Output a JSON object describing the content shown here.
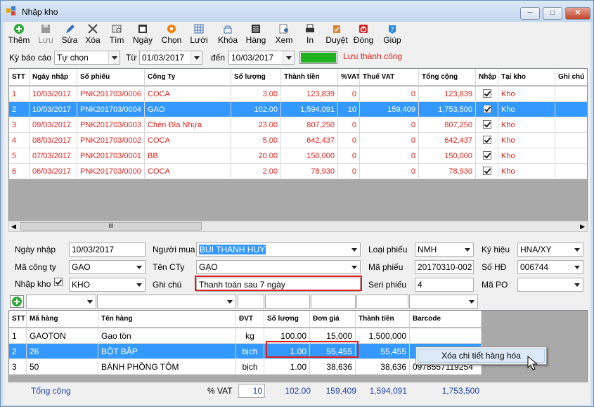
{
  "window": {
    "title": "Nhập kho",
    "btn_min": "─",
    "btn_max": "□",
    "btn_close": "✕"
  },
  "toolbar": [
    {
      "label": "Thêm",
      "icon": "add-icon",
      "color": "#2fa836",
      "enabled": true
    },
    {
      "label": "Lưu",
      "icon": "save-icon",
      "color": "#9a9a9a",
      "enabled": false
    },
    {
      "label": "Sửa",
      "icon": "edit-icon",
      "color": "#3a6fb6",
      "enabled": true
    },
    {
      "label": "Xóa",
      "icon": "delete-icon",
      "color": "#444444",
      "enabled": true
    },
    {
      "label": "Tìm",
      "icon": "find-icon",
      "color": "#555555",
      "enabled": true
    },
    {
      "label": "Ngày",
      "icon": "calendar-icon",
      "color": "#333333",
      "enabled": true
    },
    {
      "label": "Chọn",
      "icon": "gear-icon",
      "color": "#f07d00",
      "enabled": true
    },
    {
      "label": "Lưới",
      "icon": "grid-icon",
      "color": "#3a6fb6",
      "enabled": true
    },
    {
      "label": "Khóa",
      "icon": "lock-icon",
      "color": "#3a6fb6",
      "enabled": true
    },
    {
      "label": "Hàng",
      "icon": "goods-icon",
      "color": "#333333",
      "enabled": true
    },
    {
      "label": "Xem",
      "icon": "preview-icon",
      "color": "#3a6fb6",
      "enabled": true
    },
    {
      "label": "In",
      "icon": "print-icon",
      "color": "#333333",
      "enabled": true
    },
    {
      "label": "Duyệt",
      "icon": "approve-icon",
      "color": "#d9822b",
      "enabled": true
    },
    {
      "label": "Đóng",
      "icon": "power-icon",
      "color": "#d02020",
      "enabled": true
    },
    {
      "label": "Giúp",
      "icon": "help-icon",
      "color": "#2a8ad9",
      "enabled": true
    }
  ],
  "filter": {
    "period_label": "Kỳ báo cáo",
    "period_value": "Tự chọn",
    "from_label": "Từ",
    "from_date": "01/03/2017",
    "to_label": "đến",
    "to_date": "10/03/2017",
    "status_text": "Lưu thành công",
    "status_color": "#e0201a",
    "progress_color": "#1fb31f"
  },
  "receipts": {
    "columns": [
      "STT",
      "Ngày nhập",
      "Số phiếu",
      "Công Ty",
      "Số lượng",
      "Thành tiền",
      "%VAT",
      "Thuế VAT",
      "Tổng cộng",
      "Nhập",
      "Tại kho",
      "Ghi chú"
    ],
    "rows": [
      {
        "stt": "1",
        "date": "10/03/2017",
        "no": "PNK201703/0006",
        "company": "COCA",
        "qty": "3.00",
        "amount": "123,839",
        "vat": "0",
        "tax": "0",
        "total": "123,839",
        "kho": "Kho",
        "sel": false
      },
      {
        "stt": "2",
        "date": "10/03/2017",
        "no": "PNK201703/0004",
        "company": "GAO",
        "qty": "102.00",
        "amount": "1,594,091",
        "vat": "10",
        "tax": "159,409",
        "total": "1,753,500",
        "kho": "Kho",
        "sel": true
      },
      {
        "stt": "3",
        "date": "09/03/2017",
        "no": "PNK201703/0003",
        "company": "Chén Đĩa Nhựa",
        "qty": "23.00",
        "amount": "807,250",
        "vat": "0",
        "tax": "0",
        "total": "807,250",
        "kho": "Kho",
        "sel": false
      },
      {
        "stt": "4",
        "date": "08/03/2017",
        "no": "PNK201703/0002",
        "company": "COCA",
        "qty": "5.00",
        "amount": "642,437",
        "vat": "0",
        "tax": "0",
        "total": "642,437",
        "kho": "Kho",
        "sel": false
      },
      {
        "stt": "5",
        "date": "07/03/2017",
        "no": "PNK201703/0001",
        "company": "BB",
        "qty": "20.00",
        "amount": "150,000",
        "vat": "0",
        "tax": "0",
        "total": "150,000",
        "kho": "Kho",
        "sel": false
      },
      {
        "stt": "6",
        "date": "06/03/2017",
        "no": "PNK201703/0000",
        "company": "COCA",
        "qty": "2.00",
        "amount": "78,930",
        "vat": "0",
        "tax": "0",
        "total": "78,930",
        "kho": "Kho",
        "sel": false
      }
    ],
    "scroll_grip": "III"
  },
  "form": {
    "ngay_nhap_label": "Ngày nhập",
    "ngay_nhap": "10/03/2017",
    "nguoi_mua_label": "Người mua",
    "nguoi_mua": "BÙI THANH HUY",
    "loai_phieu_label": "Loại phiếu",
    "loai_phieu": "NMH",
    "ky_hieu_label": "Ký hiệu",
    "ky_hieu": "HNA/XY",
    "ma_cty_label": "Mã công ty",
    "ma_cty": "GAO",
    "ten_cty_label": "Tên CTy",
    "ten_cty": "GẠO",
    "ma_phieu_label": "Mã phiếu",
    "ma_phieu": "20170310-002",
    "so_hd_label": "Số HĐ",
    "so_hd": "006744",
    "nhap_kho_label": "Nhập kho",
    "kho": "KHO",
    "ghi_chu_label": "Ghi chú",
    "ghi_chu": "Thanh toán sau 7 ngày",
    "seri_label": "Seri phiếu",
    "seri": "4",
    "ma_po_label": "Mã PO",
    "ma_po": ""
  },
  "details": {
    "columns": [
      "STT",
      "Mã hàng",
      "Tên hàng",
      "ĐVT",
      "Số lượng",
      "Đơn giá",
      "Thành tiền",
      "Barcode"
    ],
    "rows": [
      {
        "stt": "1",
        "code": "GAOTON",
        "name": "Gạo tồn",
        "unit": "kg",
        "qty": "100.00",
        "price": "15,000",
        "amount": "1,500,000",
        "barcode": "",
        "sel": false
      },
      {
        "stt": "2",
        "code": "26",
        "name": "BỘT BẮP",
        "unit": "bịch",
        "qty": "1.00",
        "price": "55,455",
        "amount": "55,455",
        "barcode": "",
        "sel": true
      },
      {
        "stt": "3",
        "code": "50",
        "name": "BÁNH PHỒNG TÔM",
        "unit": "bịch",
        "qty": "1.00",
        "price": "38,636",
        "amount": "38,636",
        "barcode": "0978557119254",
        "sel": false
      }
    ],
    "total_label": "Tổng cộng",
    "vat_label": "%  VAT",
    "vat": "10",
    "qty_total": "102.00",
    "tax_total": "159,409",
    "amount_total": "1,594,091",
    "grand_total": "1,753,500"
  },
  "context_menu": {
    "item": "Xóa chi tiết hàng hóa"
  },
  "highlight_color": "#d82020"
}
